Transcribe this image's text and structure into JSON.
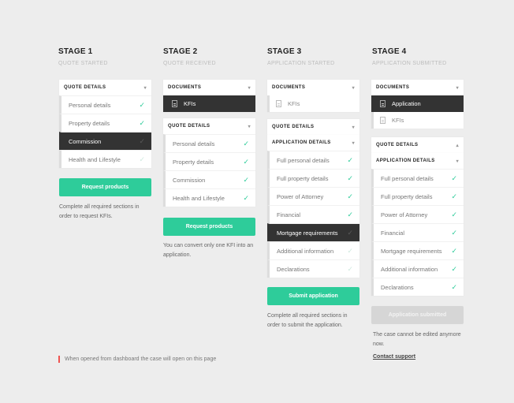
{
  "colors": {
    "accent": "#2ecc9a",
    "background": "#ededed",
    "active_row": "#333333",
    "footnote_marker": "#ef5350"
  },
  "stages": [
    {
      "title": "STAGE 1",
      "subtitle": "QUOTE STARTED"
    },
    {
      "title": "STAGE 2",
      "subtitle": "QUOTE RECEIVED"
    },
    {
      "title": "STAGE 3",
      "subtitle": "APPLICATION STARTED"
    },
    {
      "title": "STAGE 4",
      "subtitle": "APPLICATION SUBMITTED"
    }
  ],
  "stage1": {
    "quote_details": {
      "header": "QUOTE DETAILS",
      "items": [
        "Personal details",
        "Property details",
        "Commission",
        "Health and Lifestyle"
      ]
    },
    "button": "Request products",
    "note": "Complete all required sections in order to request KFIs."
  },
  "stage2": {
    "documents": {
      "header": "DOCUMENTS",
      "items": [
        "KFIs"
      ]
    },
    "quote_details": {
      "header": "QUOTE DETAILS",
      "items": [
        "Personal details",
        "Property details",
        "Commission",
        "Health and Lifestyle"
      ]
    },
    "button": "Request products",
    "note": "You can convert only one KFI into an application."
  },
  "stage3": {
    "documents": {
      "header": "DOCUMENTS",
      "items": [
        "KFIs"
      ]
    },
    "quote_details": {
      "header": "QUOTE DETAILS"
    },
    "application_details": {
      "header": "APPLICATION DETAILS",
      "items": [
        "Full personal details",
        "Full property details",
        "Power of Attorney",
        "Financial",
        "Mortgage requirements",
        "Additional information",
        "Declarations"
      ]
    },
    "button": "Submit application",
    "note": "Complete all required sections in order to submit the application."
  },
  "stage4": {
    "documents": {
      "header": "DOCUMENTS",
      "items": [
        "Application",
        "KFIs"
      ]
    },
    "quote_details": {
      "header": "QUOTE DETAILS"
    },
    "application_details": {
      "header": "APPLICATION DETAILS",
      "items": [
        "Full personal details",
        "Full property details",
        "Power of Attorney",
        "Financial",
        "Mortgage requirements",
        "Additional information",
        "Declarations"
      ]
    },
    "button": "Application submitted",
    "note": "The case cannot be edited anymore now.",
    "link": "Contact support"
  },
  "footnote": "When opened from dashboard the case will open on this page",
  "icons": {
    "chevron_down": "⌄",
    "chevron_up": "˄",
    "check": "✓"
  }
}
